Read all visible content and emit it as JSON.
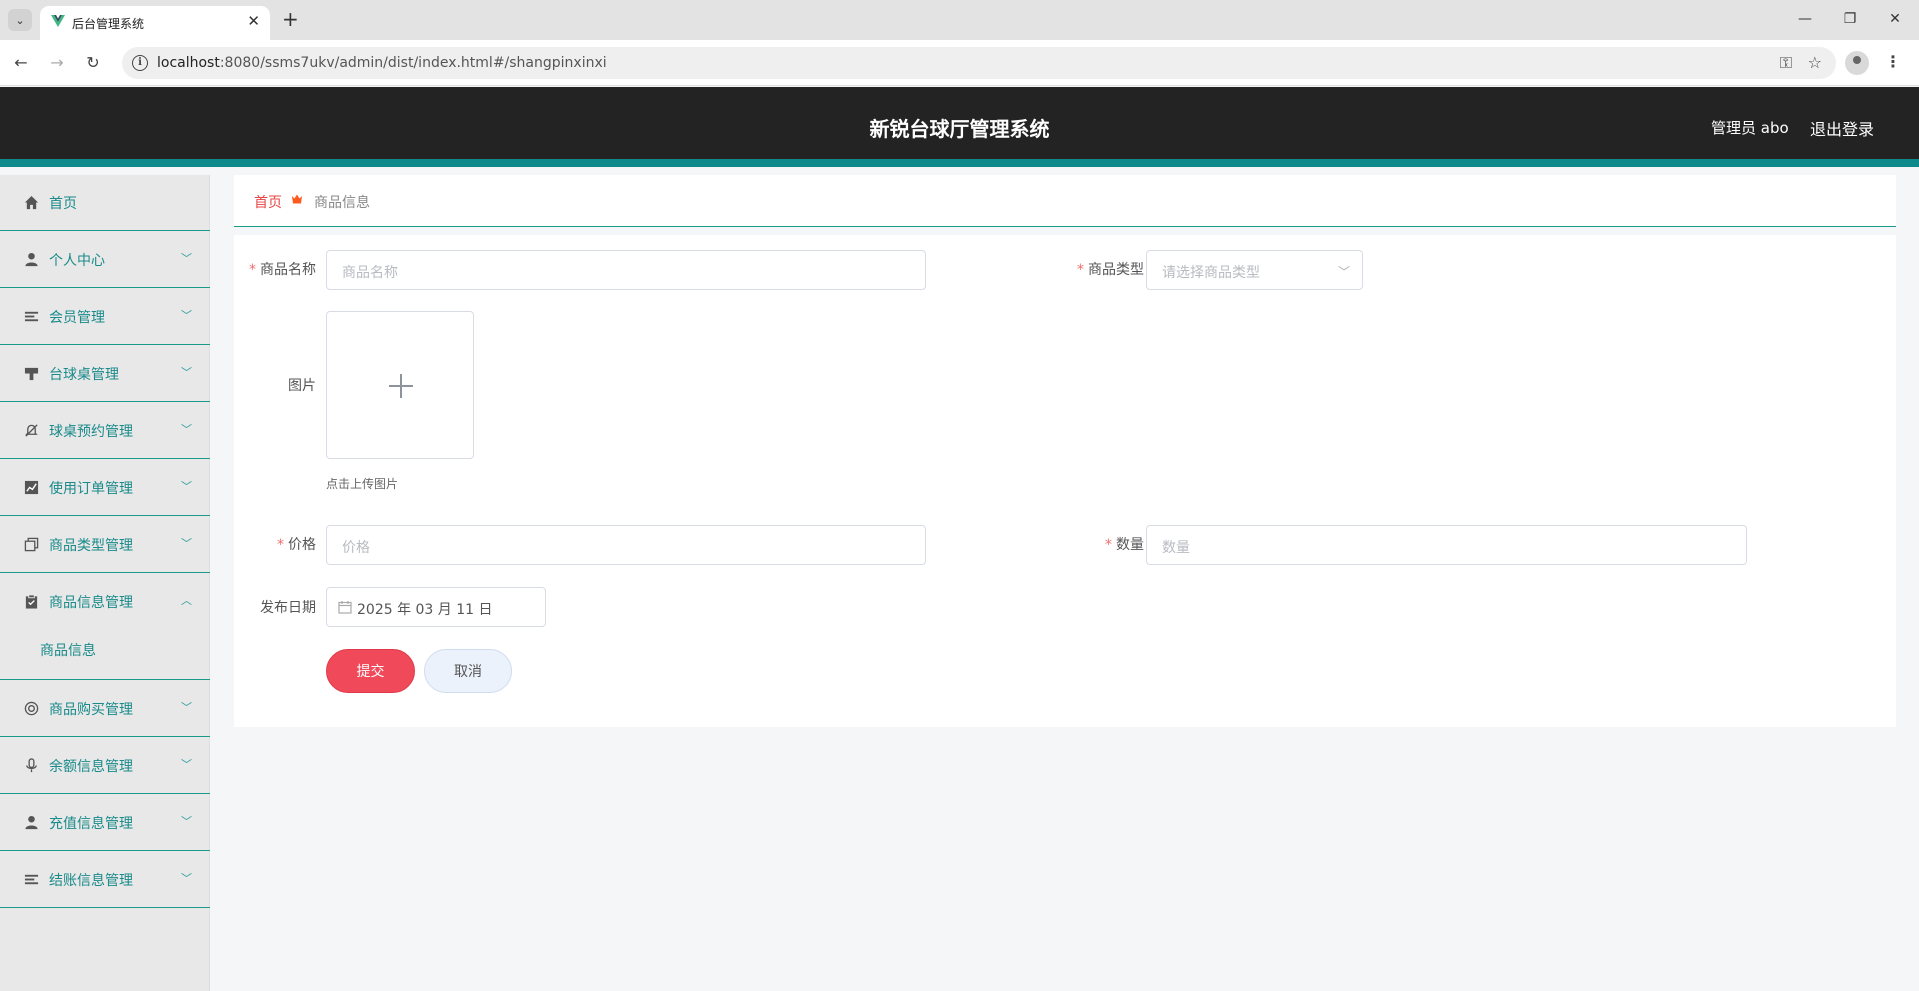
{
  "browser": {
    "tab_title": "后台管理系统",
    "url_host": "localhost",
    "url_rest": ":8080/ssms7ukv/admin/dist/index.html#/shangpinxinxi"
  },
  "header": {
    "title": "新锐台球厅管理系统",
    "user": "管理员 abo",
    "logout": "退出登录"
  },
  "sidebar": {
    "items": [
      {
        "label": "首页",
        "icon": "home-icon"
      },
      {
        "label": "个人中心",
        "icon": "user-icon"
      },
      {
        "label": "会员管理",
        "icon": "list-icon"
      },
      {
        "label": "台球桌管理",
        "icon": "table-icon"
      },
      {
        "label": "球桌预约管理",
        "icon": "bell-off-icon"
      },
      {
        "label": "使用订单管理",
        "icon": "chart-icon"
      },
      {
        "label": "商品类型管理",
        "icon": "copy-icon"
      },
      {
        "label": "商品信息管理",
        "icon": "clipboard-icon"
      },
      {
        "label": "商品购买管理",
        "icon": "lifebuoy-icon"
      },
      {
        "label": "余额信息管理",
        "icon": "mic-icon"
      },
      {
        "label": "充值信息管理",
        "icon": "user-icon"
      },
      {
        "label": "结账信息管理",
        "icon": "list-icon"
      }
    ],
    "submenu": {
      "label": "商品信息"
    }
  },
  "breadcrumb": {
    "home": "首页",
    "current": "商品信息"
  },
  "form": {
    "required_mark": "*",
    "name": {
      "label": "商品名称",
      "placeholder": "商品名称"
    },
    "type": {
      "label": "商品类型",
      "placeholder": "请选择商品类型"
    },
    "image": {
      "label": "图片",
      "tip": "点击上传图片"
    },
    "price": {
      "label": "价格",
      "placeholder": "价格"
    },
    "quantity": {
      "label": "数量",
      "placeholder": "数量"
    },
    "date": {
      "label": "发布日期",
      "value": "2025 年 03 月 11 日"
    },
    "submit": "提交",
    "cancel": "取消"
  },
  "colors": {
    "header_bg": "#232323",
    "accent_teal": "#0f8a8a",
    "submit_red": "#f04a5a",
    "breadcrumb_home": "#e84545"
  }
}
